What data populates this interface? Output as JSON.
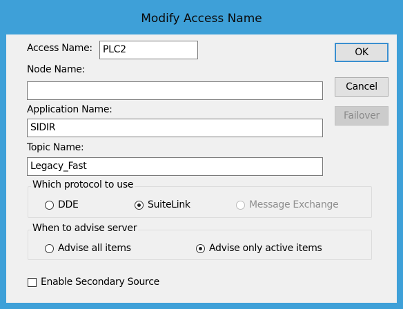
{
  "window": {
    "title": "Modify Access Name",
    "accent_color": "#3ea0d8"
  },
  "fields": {
    "access_name": {
      "label": "Access Name:",
      "value": "PLC2"
    },
    "node_name": {
      "label": "Node Name:",
      "value": ""
    },
    "application_name": {
      "label": "Application Name:",
      "value": "SIDIR"
    },
    "topic_name": {
      "label": "Topic Name:",
      "value": "Legacy_Fast"
    }
  },
  "buttons": {
    "ok": "OK",
    "cancel": "Cancel",
    "failover": "Failover"
  },
  "protocol_group": {
    "title": "Which protocol to use",
    "options": [
      "DDE",
      "SuiteLink",
      "Message Exchange"
    ],
    "selected": "SuiteLink"
  },
  "advise_group": {
    "title": "When to advise server",
    "options": [
      "Advise all items",
      "Advise only active items"
    ],
    "selected": "Advise only active items"
  },
  "secondary_source": {
    "label": "Enable Secondary Source",
    "checked": false
  }
}
